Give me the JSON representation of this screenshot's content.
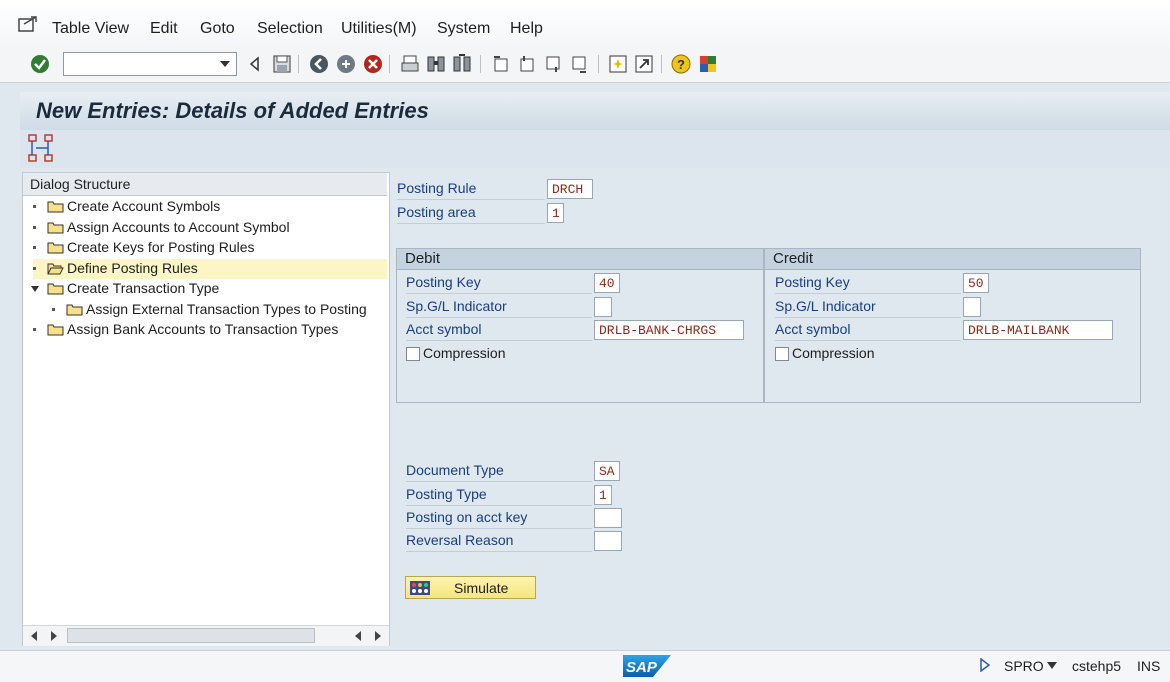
{
  "menu": {
    "items": [
      "Table View",
      "Edit",
      "Goto",
      "Selection",
      "Utilities(M)",
      "System",
      "Help"
    ]
  },
  "toolbar": {
    "command_field_value": ""
  },
  "title": "New Entries: Details of Added Entries",
  "dialog": {
    "header": "Dialog Structure",
    "items": [
      {
        "label": "Create Account Symbols"
      },
      {
        "label": "Assign Accounts to Account Symbol"
      },
      {
        "label": "Create Keys for Posting Rules"
      },
      {
        "label": "Define Posting Rules"
      },
      {
        "label": "Create Transaction Type"
      },
      {
        "label": "Assign External Transaction Types to Posting"
      },
      {
        "label": "Assign Bank Accounts to Transaction Types"
      }
    ]
  },
  "form": {
    "posting_rule_label": "Posting Rule",
    "posting_rule_value": "DRCH",
    "posting_area_label": "Posting area",
    "posting_area_value": "1",
    "debit": {
      "title": "Debit",
      "posting_key_label": "Posting Key",
      "posting_key_value": "40",
      "spgl_label": "Sp.G/L Indicator",
      "spgl_value": "",
      "acct_symbol_label": "Acct symbol",
      "acct_symbol_value": "DRLB-BANK-CHRGS",
      "compression_label": "Compression"
    },
    "credit": {
      "title": "Credit",
      "posting_key_label": "Posting Key",
      "posting_key_value": "50",
      "spgl_label": "Sp.G/L Indicator",
      "spgl_value": "",
      "acct_symbol_label": "Acct symbol",
      "acct_symbol_value": "DRLB-MAILBANK",
      "compression_label": "Compression"
    },
    "document_type_label": "Document Type",
    "document_type_value": "SA",
    "posting_type_label": "Posting Type",
    "posting_type_value": "1",
    "posting_on_acct_key_label": "Posting on acct key",
    "posting_on_acct_key_value": "",
    "reversal_reason_label": "Reversal Reason",
    "reversal_reason_value": "",
    "simulate_label": "Simulate"
  },
  "status": {
    "logo": "SAP",
    "transaction": "SPRO",
    "system": "cstehp5",
    "mode": "INS"
  },
  "colors": {
    "label_blue": "#1a3e7a",
    "value_red": "#8b2a1a",
    "accent_yellow": "#f6e67c"
  }
}
